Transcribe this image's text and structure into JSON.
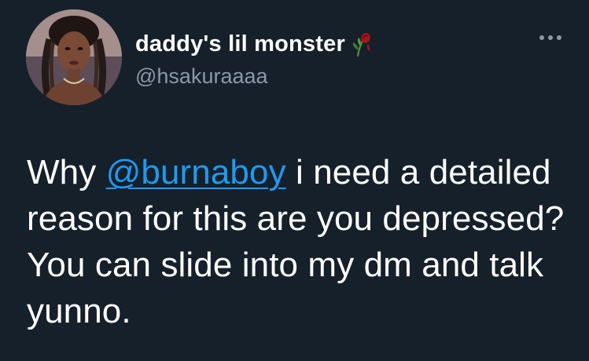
{
  "author": {
    "display_name": "daddy's lil monster",
    "name_emoji_icon": "wilted-rose-icon",
    "handle": "@hsakuraaaa",
    "avatar_icon": "profile-photo"
  },
  "actions": {
    "more_icon": "more-options-icon"
  },
  "tweet": {
    "text_before": "Why ",
    "mention": "@burnaboy",
    "text_after": " i need a detailed reason for this are you depressed? You can slide into my dm and talk yunno."
  },
  "colors": {
    "background": "#15202b",
    "text": "#ffffff",
    "secondary_text": "#8b98a5",
    "link": "#1d9bf0"
  }
}
